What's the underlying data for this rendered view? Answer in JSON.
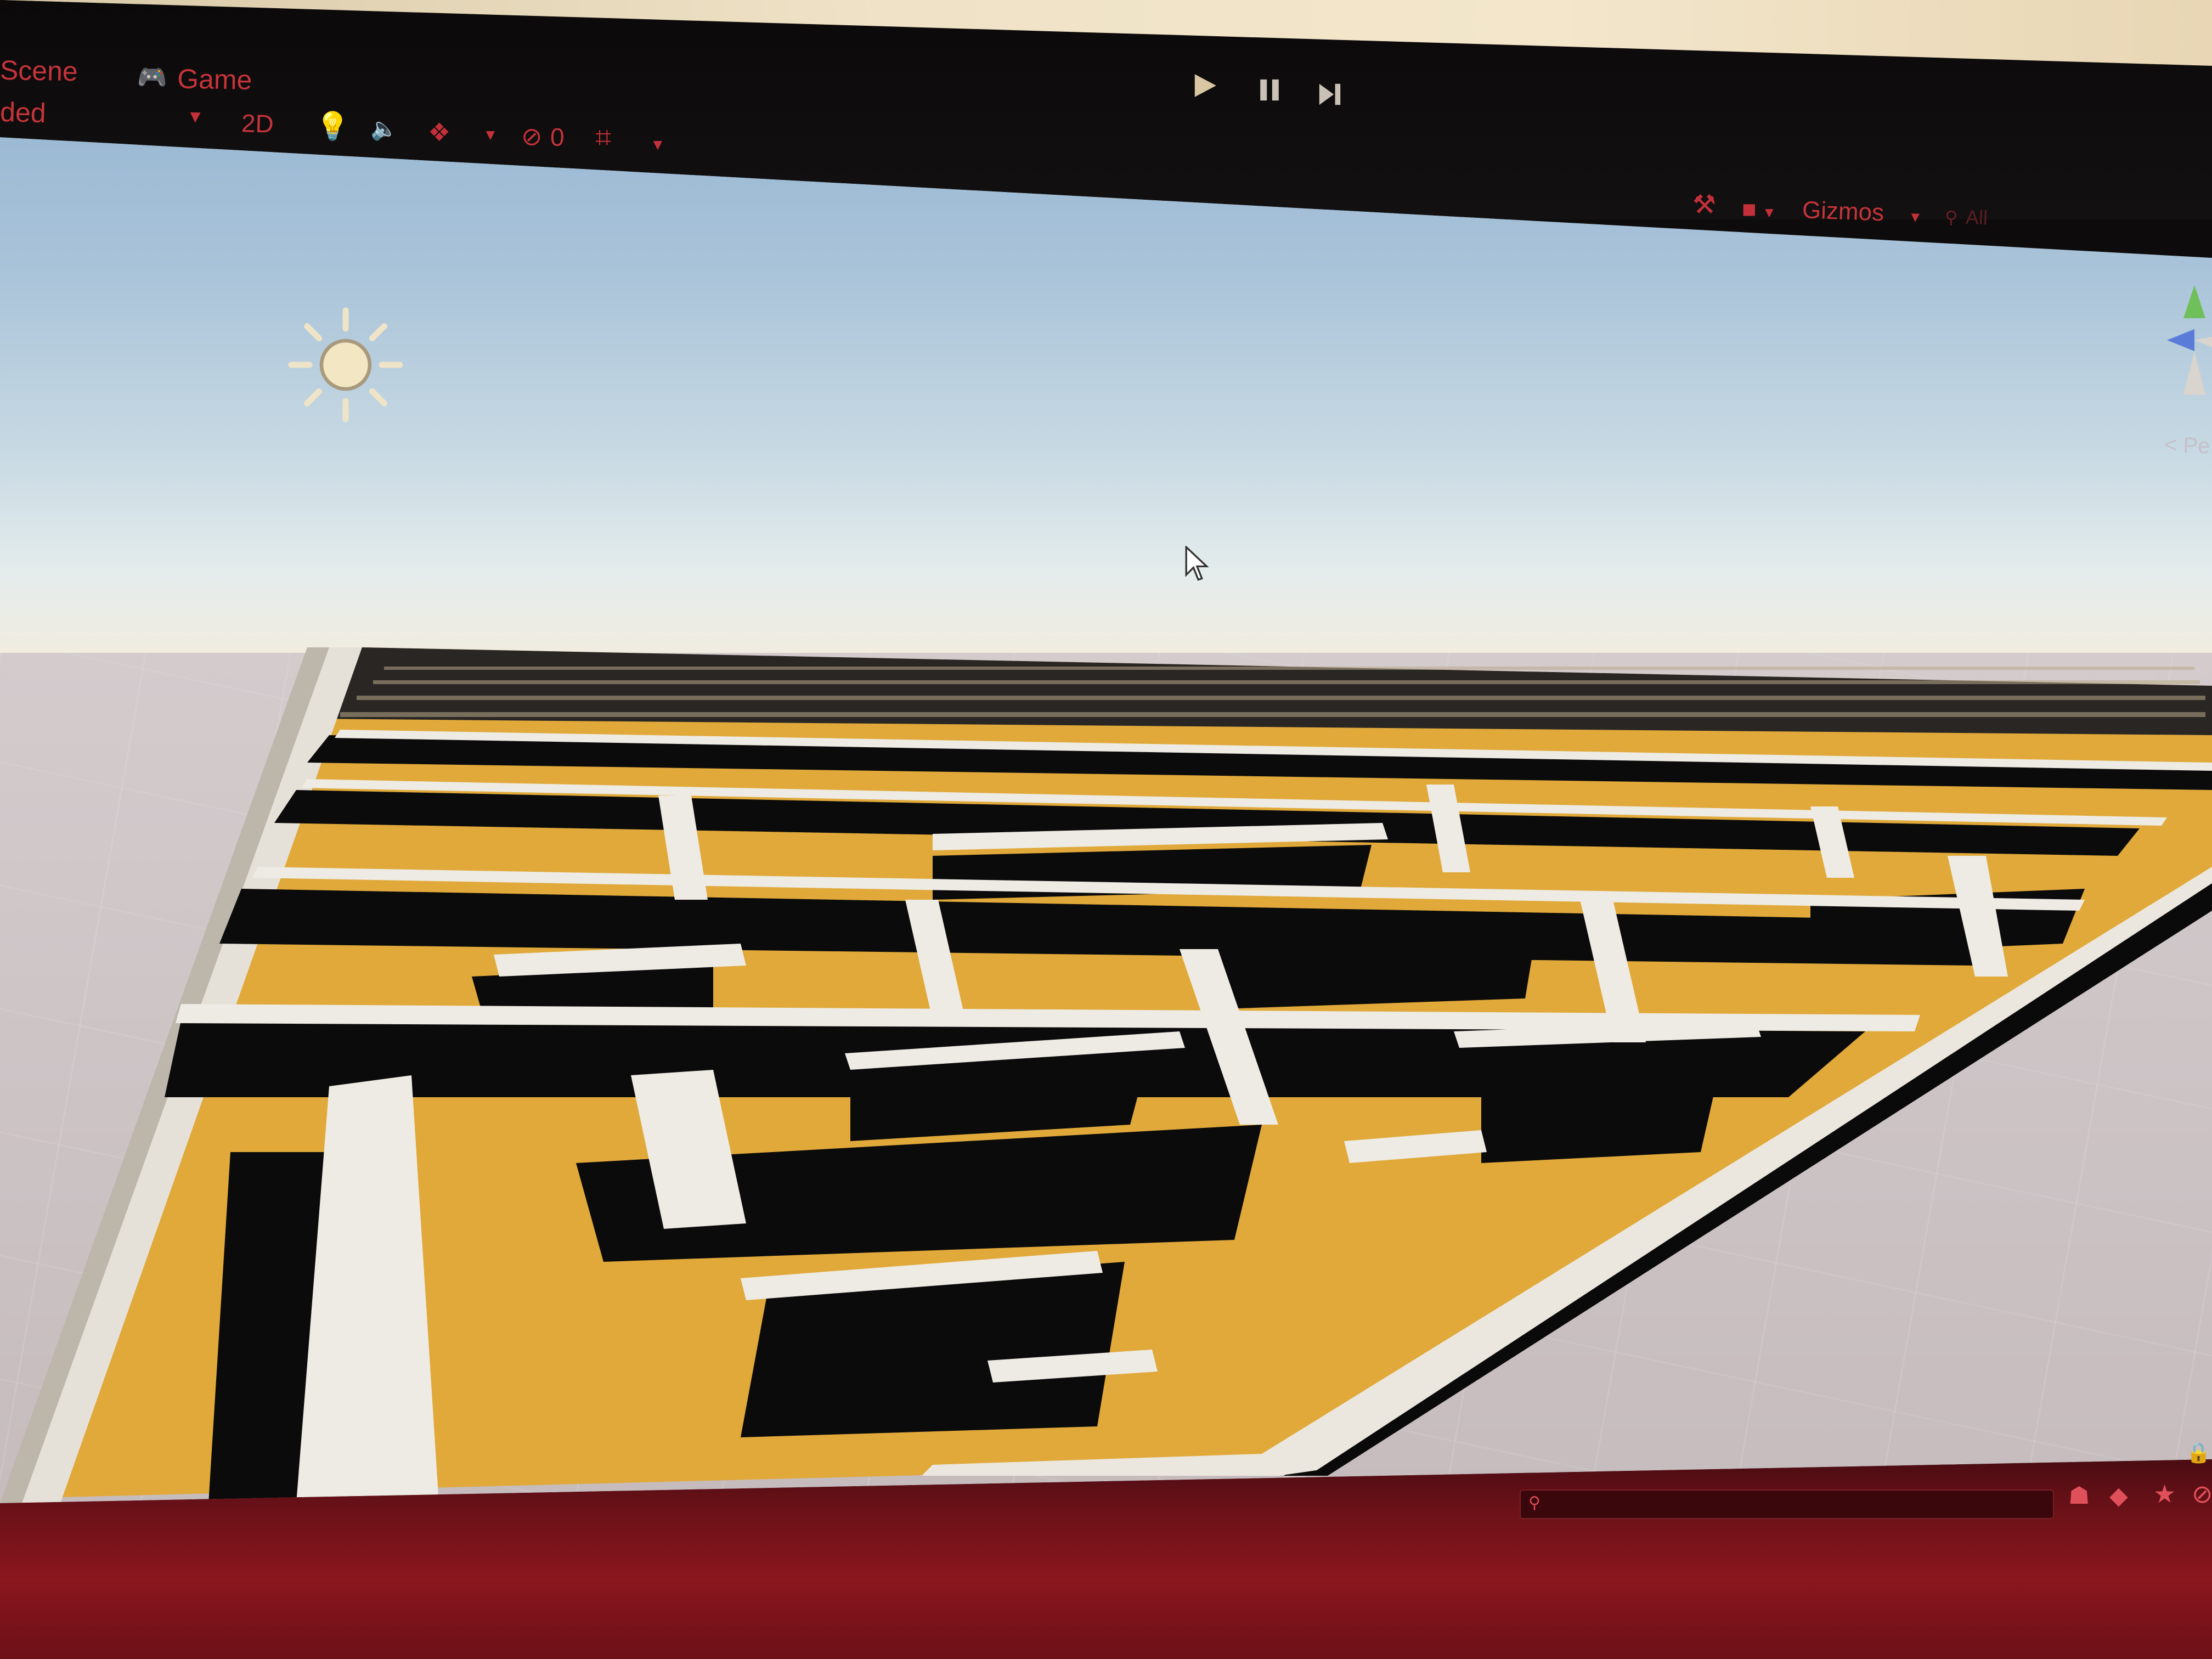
{
  "toolbar": {
    "tabs": [
      {
        "label": "Scene",
        "icon": "scene-icon"
      },
      {
        "label": "Game",
        "icon": "gamepad-icon"
      }
    ],
    "shading_mode": "ded",
    "mode_2d": "2D",
    "hidden_count": "0",
    "gizmos_label": "Gizmos",
    "search_placeholder": "All",
    "persp_label": "< Pe",
    "playback": [
      "play-icon",
      "pause-icon",
      "step-icon"
    ]
  },
  "colors": {
    "ui_tint": "#c4343a",
    "maze_floor": "#e2ad3c",
    "maze_wall_top": "#efece6",
    "maze_wall_side": "#0c0b0b",
    "bottom_panel": "#7a131a"
  },
  "scene": {
    "light_icon": "sun-icon",
    "cursor_icon": "mouse-cursor-icon",
    "orientation_gizmo_icon": "axis-gizmo-icon"
  }
}
